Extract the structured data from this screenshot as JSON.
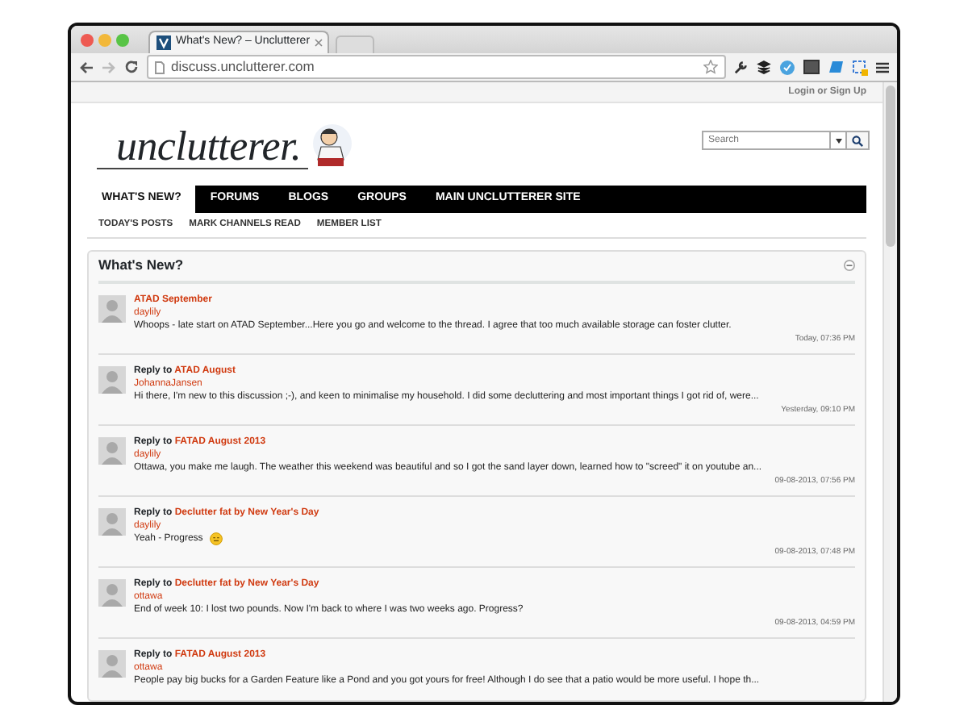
{
  "browser": {
    "tab_title": "What's New? – Unclutterer",
    "address": "discuss.unclutterer.com"
  },
  "top_bar": {
    "login": "Login or Sign Up"
  },
  "header": {
    "logo": "unclutterer.",
    "search": {
      "placeholder": "Search"
    }
  },
  "nav": [
    {
      "label": "WHAT'S NEW?",
      "selected": true
    },
    {
      "label": "FORUMS",
      "selected": false
    },
    {
      "label": "BLOGS",
      "selected": false
    },
    {
      "label": "GROUPS",
      "selected": false
    },
    {
      "label": "MAIN UNCLUTTERER SITE",
      "selected": false
    }
  ],
  "subnav": [
    "TODAY'S POSTS",
    "MARK CHANNELS READ",
    "MEMBER LIST"
  ],
  "panel": {
    "title": "What's New?",
    "posts": [
      {
        "thread": "ATAD September",
        "author": "daylily",
        "body": "Whoops - late start on ATAD September...Here you go and welcome to the thread. I agree that too much available storage can foster clutter.",
        "emoticon": false,
        "time": "Today, 07:36 PM"
      },
      {
        "prefix": "Reply to",
        "thread": "ATAD August",
        "author": "JohannaJansen",
        "body": "Hi there, I'm new to this discussion ;-), and keen to minimalise my household. I did some decluttering and most important things I got rid of, were...",
        "emoticon": false,
        "time": "Yesterday, 09:10 PM"
      },
      {
        "prefix": "Reply to",
        "thread": "FATAD August 2013",
        "author": "daylily",
        "body": "Ottawa, you make me laugh. The weather this weekend was beautiful and so I got the sand layer down, learned how to \"screed\" it on youtube an...",
        "emoticon": false,
        "time": "09-08-2013, 07:56 PM"
      },
      {
        "prefix": "Reply to",
        "thread": "Declutter fat by New Year's Day",
        "author": "daylily",
        "body": "Yeah - Progress",
        "emoticon": true,
        "time": "09-08-2013, 07:48 PM"
      },
      {
        "prefix": "Reply to",
        "thread": "Declutter fat by New Year's Day",
        "author": "ottawa",
        "body": "End of week 10: I lost two pounds. Now I'm back to where I was two weeks ago. Progress?",
        "emoticon": false,
        "time": "09-08-2013, 04:59 PM"
      },
      {
        "prefix": "Reply to",
        "thread": "FATAD August 2013",
        "author": "ottawa",
        "body": "People pay big bucks for a Garden Feature like a Pond and you got yours for free! Although I do see that a patio would be more useful. I hope th...",
        "emoticon": false
      }
    ]
  }
}
